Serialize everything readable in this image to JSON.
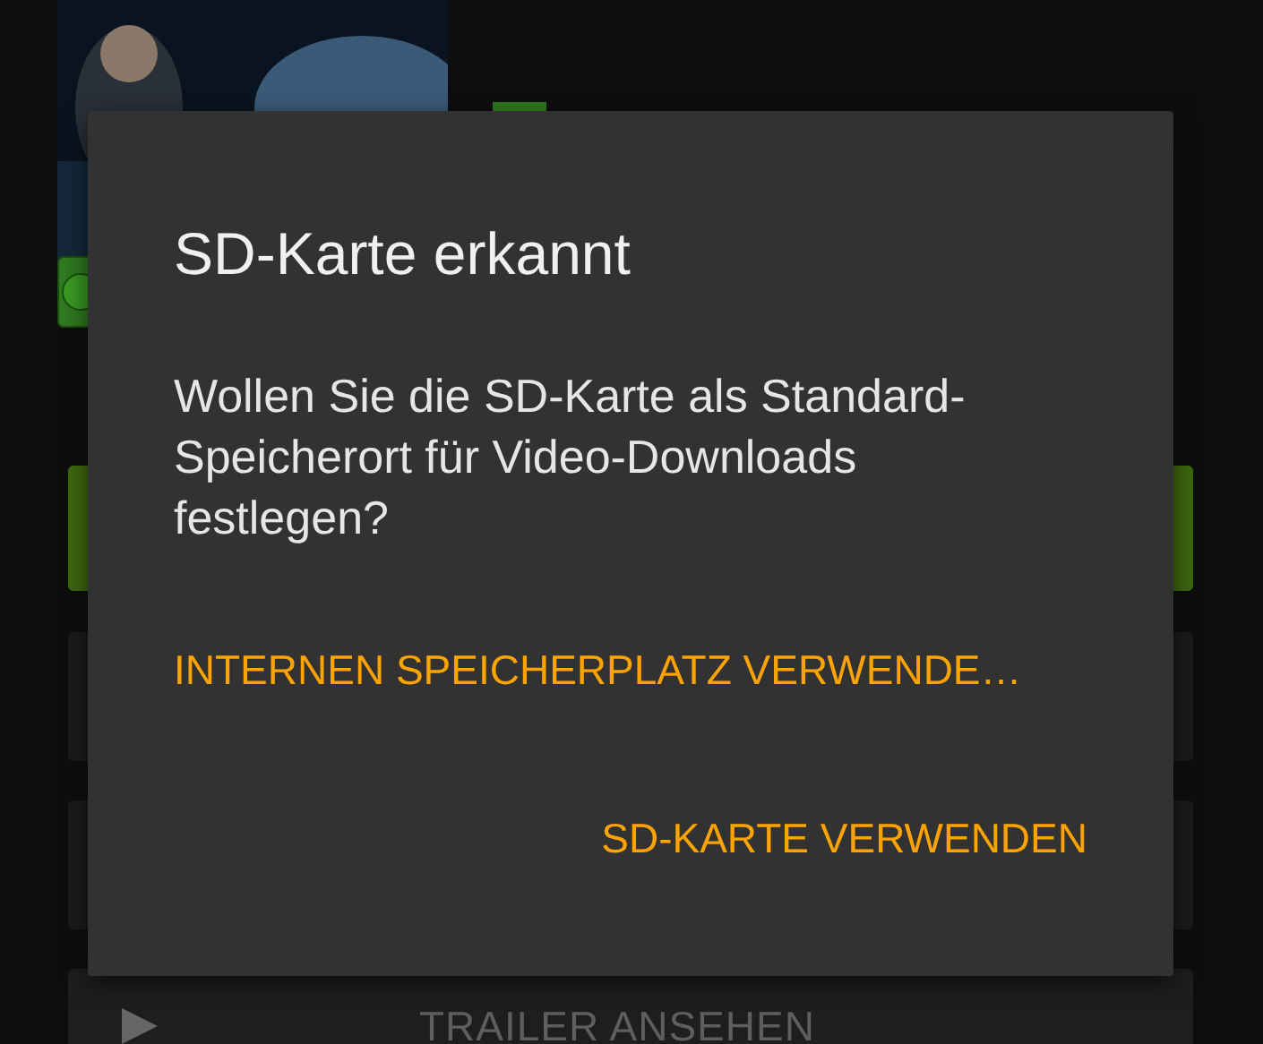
{
  "background": {
    "trailer_button": {
      "label": "TRAILER ANSEHEN"
    }
  },
  "dialog": {
    "title": "SD-Karte erkannt",
    "message": "Wollen Sie die SD-Karte als Standard-Speicherort für Video-Downloads festlegen?",
    "buttons": [
      {
        "label": "INTERNEN SPEICHERPLATZ VERWENDE…"
      },
      {
        "label": "SD-KARTE VERWENDEN"
      }
    ]
  }
}
